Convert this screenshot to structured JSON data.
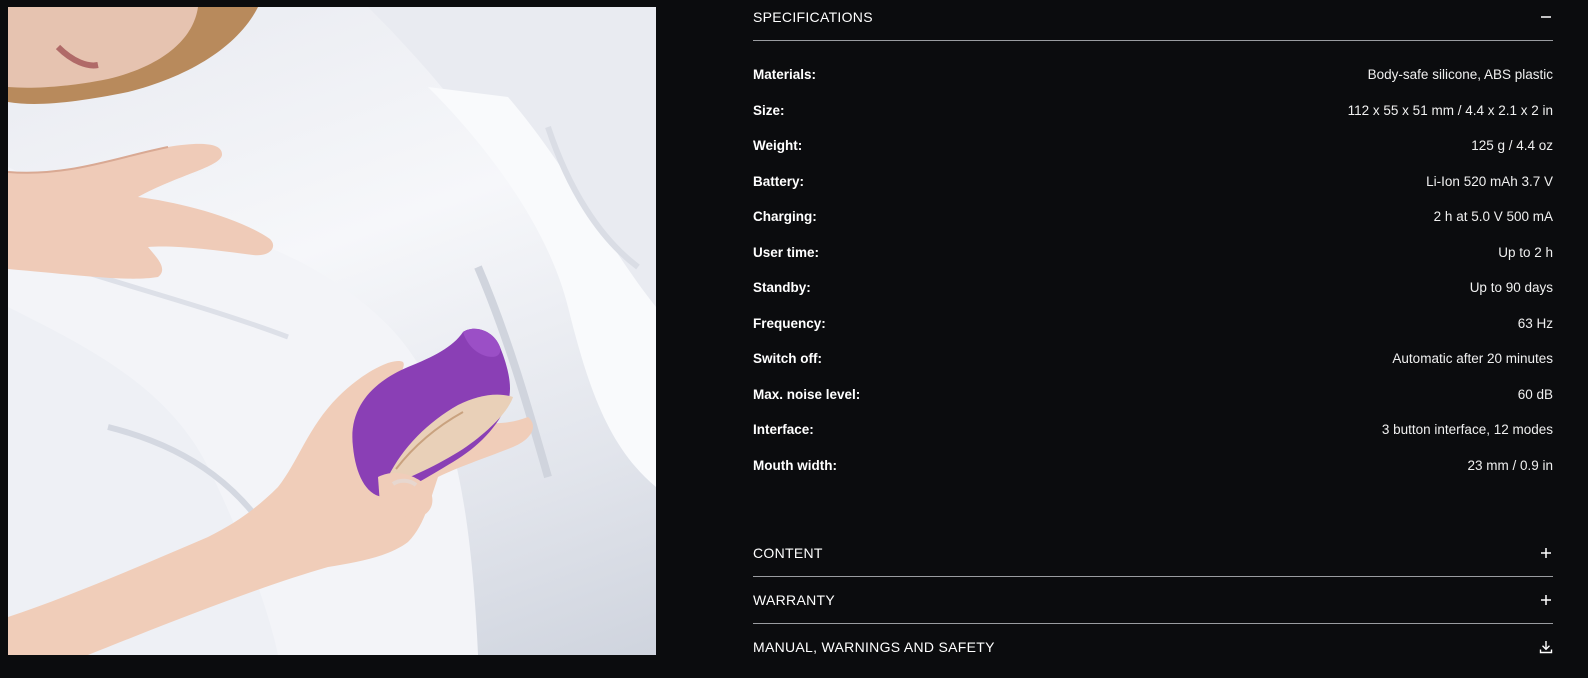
{
  "photo": {
    "description_icon": "product-photo"
  },
  "specifications": {
    "title": "SPECIFICATIONS",
    "toggle_icon": "minus-icon",
    "rows": [
      {
        "label": "Materials:",
        "value": "Body-safe silicone, ABS plastic"
      },
      {
        "label": "Size:",
        "value": "112 x 55 x 51 mm / 4.4 x 2.1 x 2 in"
      },
      {
        "label": "Weight:",
        "value": "125 g / 4.4 oz"
      },
      {
        "label": "Battery:",
        "value": "Li-Ion 520 mAh 3.7 V"
      },
      {
        "label": "Charging:",
        "value": "2 h at 5.0 V 500 mA"
      },
      {
        "label": "User time:",
        "value": "Up to 2 h"
      },
      {
        "label": "Standby:",
        "value": "Up to 90 days"
      },
      {
        "label": "Frequency:",
        "value": "63 Hz"
      },
      {
        "label": "Switch off:",
        "value": "Automatic after 20 minutes"
      },
      {
        "label": "Max. noise level:",
        "value": "60 dB"
      },
      {
        "label": "Interface:",
        "value": "3 button interface, 12 modes"
      },
      {
        "label": "Mouth width:",
        "value": "23 mm / 0.9 in"
      }
    ]
  },
  "content_section": {
    "title": "CONTENT",
    "toggle_icon": "plus-icon"
  },
  "warranty_section": {
    "title": "WARRANTY",
    "toggle_icon": "plus-icon"
  },
  "manual_section": {
    "title": "MANUAL, WARNINGS AND SAFETY",
    "toggle_icon": "download-icon"
  },
  "colors": {
    "background": "#0b0c0e",
    "text": "#ffffff",
    "divider": "#9a9ca0",
    "product_purple": "#8a3fb5"
  }
}
